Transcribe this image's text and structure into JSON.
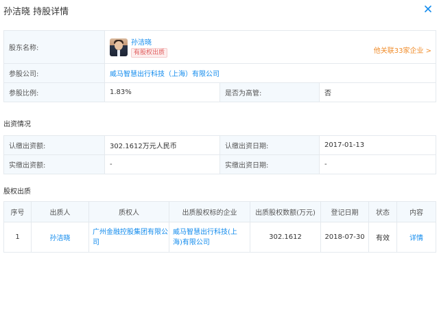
{
  "dialog": {
    "title": "孙洁晓 持股详情"
  },
  "shareholder": {
    "label": "股东名称:",
    "name": "孙洁晓",
    "tag": "有股权出质",
    "related": "他关联33家企业 >"
  },
  "company": {
    "label": "参股公司:",
    "value": "威马智慧出行科技（上海）有限公司"
  },
  "ratio": {
    "label": "参股比例:",
    "value": "1.83%"
  },
  "executive": {
    "label": "是否为高管:",
    "value": "否"
  },
  "investment": {
    "title": "出资情况",
    "subscribed_label": "认缴出资额:",
    "subscribed_value": "302.1612万元人民币",
    "subscribed_date_label": "认缴出资日期:",
    "subscribed_date_value": "2017-01-13",
    "paid_label": "实缴出资额:",
    "paid_value": "-",
    "paid_date_label": "实缴出资日期:",
    "paid_date_value": "-"
  },
  "pledge": {
    "title": "股权出质",
    "headers": [
      "序号",
      "出质人",
      "质权人",
      "出质股权标的企业",
      "出质股权数额(万元)",
      "登记日期",
      "状态",
      "内容"
    ],
    "rows": [
      {
        "no": "1",
        "pledgor": "孙洁晓",
        "pledgee_line1": "广州金融控股集团有限公",
        "pledgee_line2": "司",
        "target_line1": "威马智慧出行科技(上",
        "target_line2": "海)有限公司",
        "amount": "302.1612",
        "date": "2018-07-30",
        "status": "有效",
        "content": "详情"
      }
    ]
  },
  "colors": {
    "link": "#128bed",
    "accent_orange": "#f08c2a",
    "label_bg": "#f4f9fd",
    "border": "#e4e9ee",
    "tag_red": "#e05d5d"
  }
}
